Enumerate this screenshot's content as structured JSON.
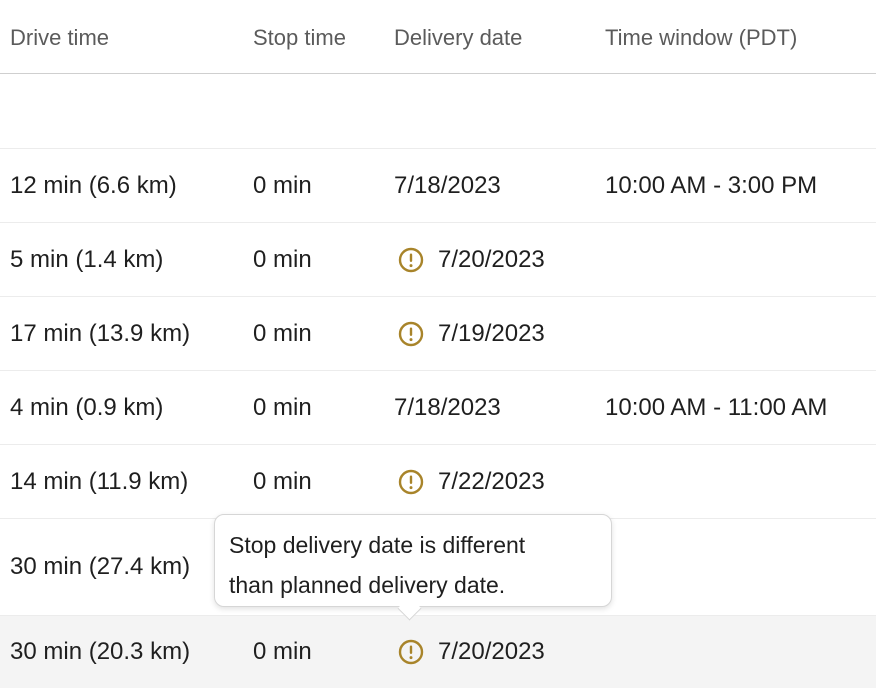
{
  "columns": {
    "drive_time": "Drive time",
    "stop_time": "Stop time",
    "delivery_date": "Delivery date",
    "time_window": "Time window (PDT)"
  },
  "rows": [
    {
      "drive": "",
      "stop": "",
      "date": "",
      "window": "",
      "warning": false
    },
    {
      "drive": "12 min (6.6 km)",
      "stop": "0 min",
      "date": "7/18/2023",
      "window": "10:00 AM - 3:00 PM",
      "warning": false
    },
    {
      "drive": "5 min (1.4 km)",
      "stop": "0 min",
      "date": "7/20/2023",
      "window": "",
      "warning": true
    },
    {
      "drive": "17 min (13.9 km)",
      "stop": "0 min",
      "date": "7/19/2023",
      "window": "",
      "warning": true
    },
    {
      "drive": "4 min (0.9 km)",
      "stop": "0 min",
      "date": "7/18/2023",
      "window": "10:00 AM - 11:00 AM",
      "warning": false
    },
    {
      "drive": "14 min (11.9 km)",
      "stop": "0 min",
      "date": "7/22/2023",
      "window": "",
      "warning": true
    },
    {
      "drive": "30 min (27.4 km)",
      "stop": "",
      "date": "",
      "window": "",
      "warning": false
    },
    {
      "drive": "30 min (20.3 km)",
      "stop": "0 min",
      "date": "7/20/2023",
      "window": "",
      "warning": true
    }
  ],
  "tooltip": {
    "line1": "Stop delivery date is different",
    "line2": "than planned delivery date."
  },
  "colors": {
    "warning": "#a8842a",
    "row_highlight": "#f4f4f4"
  },
  "icons": {
    "warning": "warning-circle-icon"
  }
}
